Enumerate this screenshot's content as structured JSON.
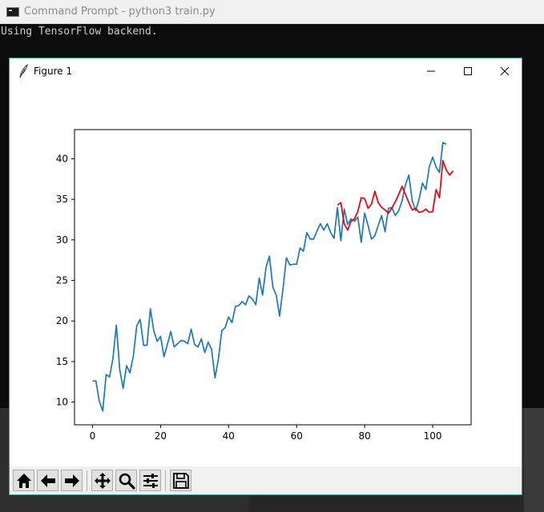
{
  "cmd": {
    "title": "Command Prompt - python3  train.py",
    "console_line": "Using TensorFlow backend."
  },
  "figure": {
    "title": "Figure 1"
  },
  "toolbar": {
    "buttons": [
      "home-icon",
      "back-arrow-icon",
      "forward-arrow-icon",
      "pan-icon",
      "zoom-icon",
      "configure-subplots-icon",
      "save-icon"
    ]
  },
  "colors": {
    "actual": "#1f77b4",
    "predicted": "#e8000b"
  },
  "chart_data": {
    "type": "line",
    "title": "",
    "xlabel": "",
    "ylabel": "",
    "xlim": [
      -5.3,
      111.3
    ],
    "ylim": [
      7.2,
      43.6
    ],
    "xticks": [
      0,
      20,
      40,
      60,
      80,
      100
    ],
    "yticks": [
      10,
      15,
      20,
      25,
      30,
      35,
      40
    ],
    "grid": false,
    "series": [
      {
        "color": "#1f77b4",
        "x_start": 0,
        "values": [
          12.6,
          12.6,
          10.1,
          8.9,
          13.4,
          13.1,
          15.4,
          19.5,
          14.0,
          11.7,
          14.5,
          13.6,
          15.7,
          19.4,
          20.2,
          17.0,
          17.0,
          21.5,
          18.8,
          17.5,
          18.1,
          15.6,
          17.1,
          18.7,
          16.8,
          17.2,
          17.6,
          17.5,
          17.2,
          19.0,
          17.1,
          16.8,
          17.8,
          16.1,
          17.4,
          16.5,
          13.0,
          15.3,
          18.8,
          19.2,
          20.5,
          19.8,
          21.8,
          21.9,
          22.4,
          22.0,
          23.1,
          22.7,
          22.0,
          25.3,
          23.2,
          26.6,
          28.0,
          24.2,
          23.2,
          20.6,
          24.0,
          27.8,
          26.9,
          27.0,
          27.0,
          29.0,
          28.6,
          30.9,
          30.1,
          30.1,
          31.1,
          32.0,
          31.2,
          32.0,
          30.9,
          30.2,
          34.0,
          29.9,
          33.8,
          31.9,
          32.6,
          32.3,
          32.8,
          29.7,
          33.3,
          31.8,
          30.1,
          30.5,
          31.8,
          33.0,
          31.0,
          33.9,
          34.0,
          33.0,
          33.6,
          34.8,
          36.8,
          38.0,
          34.8,
          33.6,
          35.0,
          37.0,
          36.2,
          39.0,
          40.2,
          39.0,
          38.3,
          42.0,
          41.8
        ]
      },
      {
        "color": "#e8000b",
        "x_start": 72,
        "values": [
          34.3,
          34.6,
          32.0,
          31.2,
          32.3,
          32.6,
          33.5,
          35.2,
          35.1,
          33.9,
          34.4,
          36.0,
          34.6,
          34.0,
          33.7,
          33.3,
          33.9,
          34.7,
          35.6,
          36.6,
          35.6,
          34.6,
          33.7,
          33.9,
          33.4,
          33.5,
          33.8,
          33.4,
          33.5,
          36.2,
          35.2,
          39.8,
          38.6,
          38.0,
          38.5
        ]
      }
    ]
  }
}
